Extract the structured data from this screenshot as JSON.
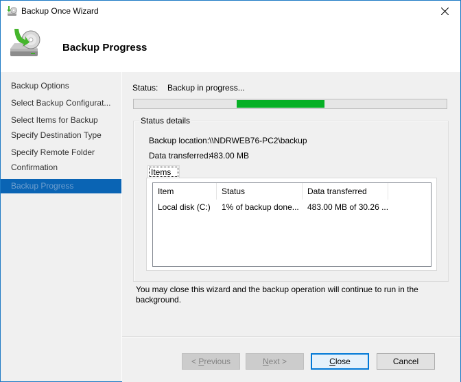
{
  "window": {
    "title": "Backup Once Wizard",
    "close_icon": "close-icon",
    "app_icon": "backup-disk-icon"
  },
  "header": {
    "title": "Backup Progress",
    "icon": "backup-disk-icon"
  },
  "sidebar": {
    "items": [
      {
        "label": "Backup Options",
        "active": false
      },
      {
        "label": "Select Backup Configurat...",
        "active": false
      },
      {
        "label": "Select Items for Backup",
        "active": false
      },
      {
        "label": "Specify Destination Type",
        "active": false
      },
      {
        "label": "Specify Remote Folder",
        "active": false
      },
      {
        "label": "Confirmation",
        "active": false
      },
      {
        "label": "Backup Progress",
        "active": true
      }
    ]
  },
  "main": {
    "status_label": "Status:",
    "status_value": "Backup in progress...",
    "progress": {
      "mode": "marquee",
      "segment_start_fraction": 0.33,
      "segment_end_fraction": 0.61,
      "color": "#06b025"
    },
    "status_details": {
      "legend": "Status details",
      "backup_location_label": "Backup location:",
      "backup_location_value": "\\\\NDRWEB76-PC2\\backup",
      "data_transferred_label": "Data transferred:",
      "data_transferred_value": "483.00 MB",
      "tab_label": "Items",
      "list": {
        "columns": [
          "Item",
          "Status",
          "Data transferred"
        ],
        "rows": [
          [
            "Local disk (C:)",
            "1% of backup done...",
            "483.00 MB of 30.26 ..."
          ]
        ]
      }
    },
    "note": "You may close this wizard and the backup operation will continue to run in the background."
  },
  "footer": {
    "previous_prefix": "< ",
    "previous_access": "P",
    "previous_rest": "revious",
    "next_access": "N",
    "next_rest": "ext >",
    "close_access": "C",
    "close_rest": "lose",
    "cancel": "Cancel"
  },
  "colors": {
    "accent": "#0a64b4",
    "window_border": "#1c79c4",
    "progress": "#06b025"
  }
}
